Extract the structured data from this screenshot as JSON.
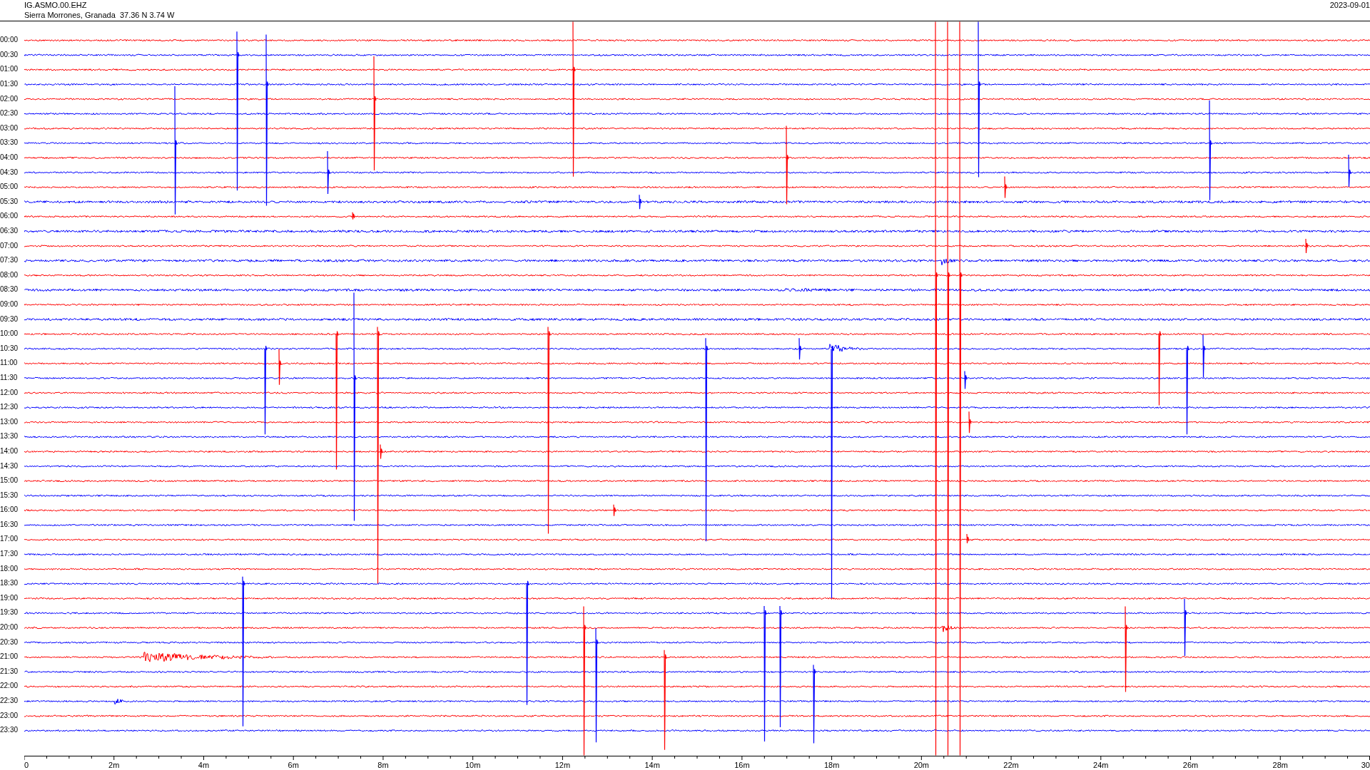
{
  "header": {
    "station": "IG.ASMO.00.EHZ",
    "location": "Sierra Morrones, Granada  37.36 N 3.74 W",
    "date": "2023-09-01"
  },
  "rows": [
    {
      "time": "00:00",
      "color": "#ff0000"
    },
    {
      "time": "00:30",
      "color": "#0000ff"
    },
    {
      "time": "01:00",
      "color": "#ff0000"
    },
    {
      "time": "01:30",
      "color": "#0000ff"
    },
    {
      "time": "02:00",
      "color": "#ff0000"
    },
    {
      "time": "02:30",
      "color": "#0000ff"
    },
    {
      "time": "03:00",
      "color": "#ff0000"
    },
    {
      "time": "03:30",
      "color": "#0000ff"
    },
    {
      "time": "04:00",
      "color": "#ff0000"
    },
    {
      "time": "04:30",
      "color": "#0000ff"
    },
    {
      "time": "05:00",
      "color": "#ff0000"
    },
    {
      "time": "05:30",
      "color": "#0000ff"
    },
    {
      "time": "06:00",
      "color": "#ff0000"
    },
    {
      "time": "06:30",
      "color": "#0000ff"
    },
    {
      "time": "07:00",
      "color": "#ff0000"
    },
    {
      "time": "07:30",
      "color": "#0000ff"
    },
    {
      "time": "08:00",
      "color": "#ff0000"
    },
    {
      "time": "08:30",
      "color": "#0000ff"
    },
    {
      "time": "09:00",
      "color": "#ff0000"
    },
    {
      "time": "09:30",
      "color": "#0000ff"
    },
    {
      "time": "10:00",
      "color": "#ff0000"
    },
    {
      "time": "10:30",
      "color": "#0000ff"
    },
    {
      "time": "11:00",
      "color": "#ff0000"
    },
    {
      "time": "11:30",
      "color": "#0000ff"
    },
    {
      "time": "12:00",
      "color": "#ff0000"
    },
    {
      "time": "12:30",
      "color": "#0000ff"
    },
    {
      "time": "13:00",
      "color": "#ff0000"
    },
    {
      "time": "13:30",
      "color": "#0000ff"
    },
    {
      "time": "14:00",
      "color": "#ff0000"
    },
    {
      "time": "14:30",
      "color": "#0000ff"
    },
    {
      "time": "15:00",
      "color": "#ff0000"
    },
    {
      "time": "15:30",
      "color": "#0000ff"
    },
    {
      "time": "16:00",
      "color": "#ff0000"
    },
    {
      "time": "16:30",
      "color": "#0000ff"
    },
    {
      "time": "17:00",
      "color": "#ff0000"
    },
    {
      "time": "17:30",
      "color": "#0000ff"
    },
    {
      "time": "18:00",
      "color": "#ff0000"
    },
    {
      "time": "18:30",
      "color": "#0000ff"
    },
    {
      "time": "19:00",
      "color": "#ff0000"
    },
    {
      "time": "19:30",
      "color": "#0000ff"
    },
    {
      "time": "20:00",
      "color": "#ff0000"
    },
    {
      "time": "20:30",
      "color": "#0000ff"
    },
    {
      "time": "21:00",
      "color": "#ff0000"
    },
    {
      "time": "21:30",
      "color": "#0000ff"
    },
    {
      "time": "22:00",
      "color": "#ff0000"
    },
    {
      "time": "22:30",
      "color": "#0000ff"
    },
    {
      "time": "23:00",
      "color": "#ff0000"
    },
    {
      "time": "23:30",
      "color": "#0000ff"
    }
  ],
  "x_axis": {
    "labels": [
      "0",
      "2m",
      "4m",
      "6m",
      "8m",
      "10m",
      "12m",
      "14m",
      "16m",
      "18m",
      "20m",
      "22m",
      "24m",
      "26m",
      "28m",
      "30"
    ]
  }
}
